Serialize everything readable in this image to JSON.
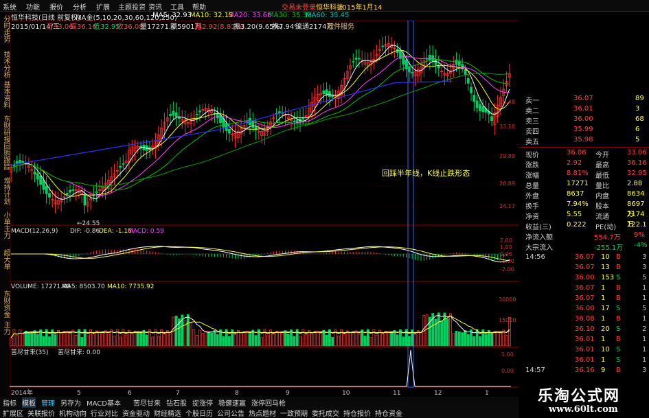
{
  "menu": [
    "系统",
    "功能",
    "报价",
    "分析",
    "扩展",
    "主题投资",
    "资讯",
    "工具",
    "帮助"
  ],
  "menu_status": "交易未登录",
  "menu_stock": "恒华科技",
  "menu_date": "2015年1月14",
  "ma_line": {
    "title": "恒华科技(日线 前复权)",
    "ma_label": "MA金(5,10,20,30,60,120,250)",
    "ma5": "MA5: 32.93",
    "ma10": "MA10: 32.15",
    "ma20": "MA20: 33.68",
    "ma30": "MA30: 35.39",
    "ma60": "MA60: 35.45"
  },
  "quote_line": {
    "date": "2015/01/14/三",
    "open": "开33.06",
    "high": "高36.16",
    "low": "低32.95",
    "close": "收36.08",
    "volume": "量17271.4",
    "amount": "额5901万",
    "change": "幅2.92(8.81%)",
    "amplitude": "振3.20(9.65%)",
    "turnover": "换7.94%",
    "float": "流通2174万",
    "sector": "软件服务"
  },
  "left_tabs": [
    "分时走势",
    "技术分析",
    "基本资料",
    "东财研报",
    "回购跟踪",
    "增持计划",
    "小单主力",
    "超大单",
    "东财资金",
    "主力"
  ],
  "price_axis": [
    "36.48",
    "33.16",
    "29.89",
    "26.89",
    "24.17"
  ],
  "low_label": "24.55",
  "annotation": "回踩半年线，K线止跌形态",
  "macd_header": {
    "label": "MACD(12,26,9)",
    "dif": "DIF: -0.86",
    "dea": "DEA: -1.16",
    "macd": "MACD: 0.59"
  },
  "macd_axis": [
    "2.00",
    "1.00",
    "0.00",
    "-1.00",
    "-2.00"
  ],
  "vol_header": {
    "vol": "VOLUME: 17271.40",
    "ma5": "MA5: 8503.70",
    "ma10": "MA10: 7735.92"
  },
  "vol_axis": [
    "30000",
    "15000"
  ],
  "fourth_header": {
    "name": "苦尽甘来(35)",
    "value": "苦尽甘来: 0.00"
  },
  "fourth_axis": [
    "1.00",
    "0.00"
  ],
  "time_axis": [
    "2014年",
    "5",
    "6",
    "7",
    "8",
    "9",
    "10",
    "11",
    "12",
    "1"
  ],
  "order_book": [
    {
      "label": "卖一",
      "price": "36.07",
      "vol": "89"
    },
    {
      "label": "卖二",
      "price": "36.01",
      "vol": "3"
    },
    {
      "label": "卖三",
      "price": "36.00",
      "vol": "68"
    },
    {
      "label": "卖四",
      "price": "35.99",
      "vol": "6"
    },
    {
      "label": "卖五",
      "price": "35.98",
      "vol": "5"
    }
  ],
  "stats": [
    {
      "l1": "现价",
      "v1": "36.08",
      "l2": "今开",
      "v2": "33.06"
    },
    {
      "l1": "涨跌",
      "v1": "2.92",
      "l2": "最高",
      "v2": "36.16"
    },
    {
      "l1": "涨幅",
      "v1": "8.81%",
      "l2": "最低",
      "v2": "32.95"
    },
    {
      "l1": "总量",
      "v1": "17271",
      "l2": "量比",
      "v2": "2.88"
    },
    {
      "l1": "外盘",
      "v1": "8637",
      "l2": "内盘",
      "v2": "8634"
    },
    {
      "l1": "换手",
      "v1": "7.94%",
      "l2": "股本",
      "v2": "8697万"
    },
    {
      "l1": "净资",
      "v1": "5.55",
      "l2": "流通",
      "v2": "2174万"
    },
    {
      "l1": "收益(三)",
      "v1": "0.222",
      "l2": "PE(动)",
      "v2": "122.1"
    }
  ],
  "flows": [
    {
      "label": "净流入额",
      "value": "554.7万",
      "pct": "9%"
    },
    {
      "label": "大宗流入",
      "value": "-255.1万",
      "pct": "-4%"
    }
  ],
  "ticks": [
    {
      "time": "14:56",
      "price": "36.07",
      "vol": "10",
      "side": "B",
      "n": "3"
    },
    {
      "time": "",
      "price": "36.07",
      "vol": "13",
      "side": "B",
      "n": "3"
    },
    {
      "time": "",
      "price": "36.00",
      "vol": "153",
      "side": "S",
      "n": "5"
    },
    {
      "time": "",
      "price": "36.07",
      "vol": "1",
      "side": "B",
      "n": "1"
    },
    {
      "time": "",
      "price": "36.07",
      "vol": "1",
      "side": "B",
      "n": "1"
    },
    {
      "time": "",
      "price": "36.00",
      "vol": "17",
      "side": "S",
      "n": "5"
    },
    {
      "time": "",
      "price": "36.08",
      "vol": "1",
      "side": "B",
      "n": "1"
    },
    {
      "time": "",
      "price": "36.10",
      "vol": "20",
      "side": "S",
      "n": "2"
    },
    {
      "time": "",
      "price": "36.01",
      "vol": "1",
      "side": "B",
      "n": "1"
    },
    {
      "time": "",
      "price": "36.01",
      "vol": "10",
      "side": "S",
      "n": "1"
    },
    {
      "time": "",
      "price": "36.01",
      "vol": "1",
      "side": "S",
      "n": "1"
    },
    {
      "time": "14:57",
      "price": "36.16",
      "vol": "9",
      "side": "B",
      "n": "3"
    }
  ],
  "bottom_tabs_row1": [
    "指标",
    "模板",
    "管理",
    "另存为",
    "MACD基本",
    "苦尽甘来",
    "钻石股",
    "捉涨停",
    "稳健速赢",
    "涨停回马枪"
  ],
  "bottom_tabs_row2": [
    "扩展区",
    "关联报价",
    "机构动向",
    "行业对比",
    "资金驱动",
    "财经精选",
    "个股日历",
    "公司公告",
    "热点题材",
    "一致预期",
    "委托成交",
    "持仓报价",
    "持仓资金"
  ],
  "brand": {
    "name": "乐淘公式网",
    "url": "www.60lt.com"
  },
  "colors": {
    "up": "#ff3030",
    "down": "#00d060",
    "axis": "#8c0000",
    "text_yellow": "#e8c060",
    "ma_white": "#ffffff",
    "ma_yellow": "#ffff00",
    "ma_magenta": "#ff40ff",
    "ma_green": "#00c000",
    "ma_blue": "#3030ff",
    "cyan": "#40c0ff"
  }
}
